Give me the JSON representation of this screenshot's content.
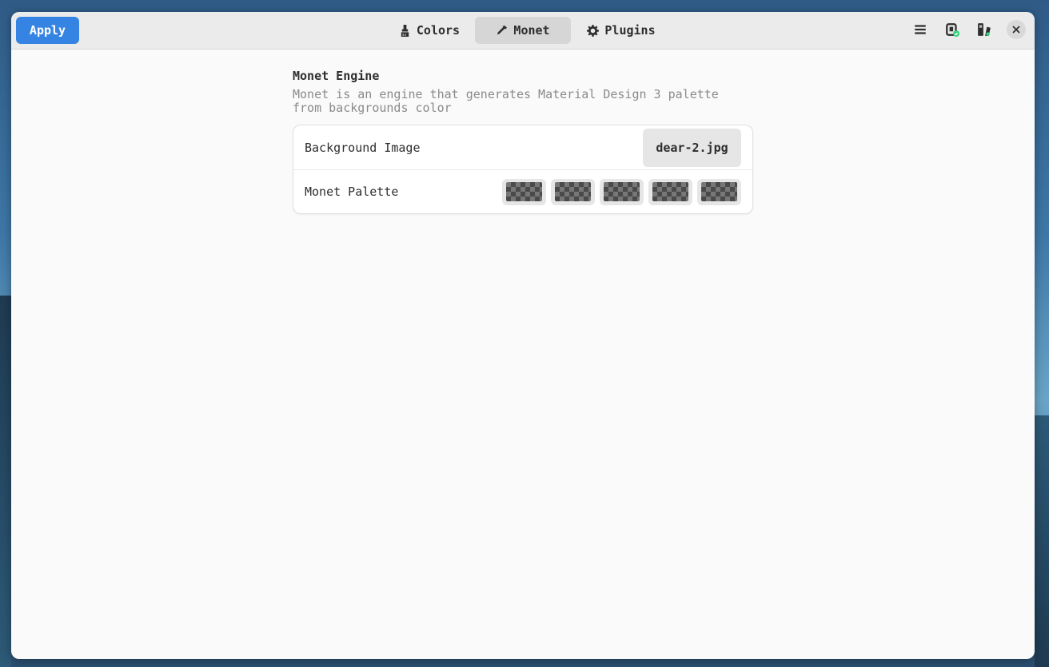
{
  "header": {
    "apply_label": "Apply",
    "tabs": [
      {
        "label": "Colors",
        "icon": "brush-icon"
      },
      {
        "label": "Monet",
        "icon": "eyedropper-icon",
        "active": true
      },
      {
        "label": "Plugins",
        "icon": "gear-icon"
      }
    ],
    "actions": [
      {
        "name": "menu-icon"
      },
      {
        "name": "clipboard-check-icon"
      },
      {
        "name": "theme-icon"
      },
      {
        "name": "close-icon"
      }
    ]
  },
  "monet": {
    "title": "Monet Engine",
    "description": "Monet is an engine that generates Material Design 3 palette from backgrounds color",
    "background_label": "Background Image",
    "background_file": "dear-2.jpg",
    "palette_label": "Monet Palette",
    "palette_count": 5
  },
  "colors": {
    "accent": "#3584e4",
    "window_bg": "#fafafa",
    "header_bg": "#ebebeb"
  }
}
